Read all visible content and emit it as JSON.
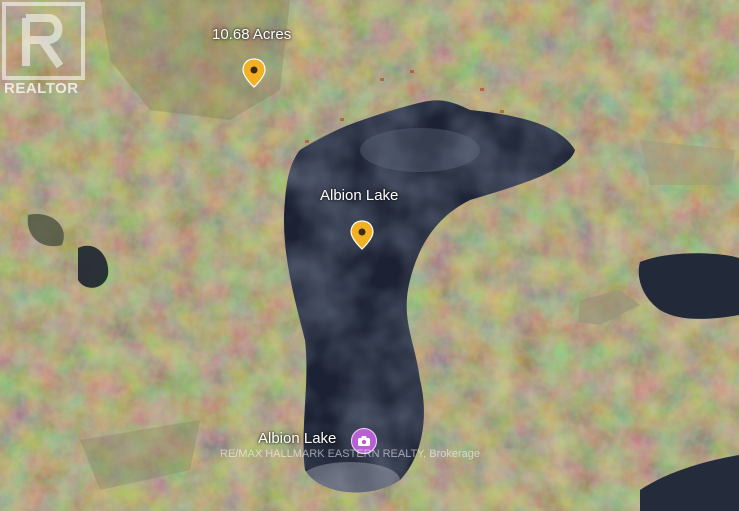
{
  "map": {
    "view": "satellite",
    "colors": {
      "lake": "#1c2233",
      "forest": "#4a4a2e",
      "marker": "#f2b022",
      "camera_badge": "#b85fd6"
    }
  },
  "markers": [
    {
      "label": "10.68 Acres",
      "icon": "map-pin-icon"
    },
    {
      "label": "Albion Lake",
      "icon": "map-pin-icon"
    }
  ],
  "place_label": {
    "text": "Albion Lake",
    "icon": "camera-icon"
  },
  "watermark": "RE/MAX HALLMARK EASTERN REALTY, Brokerage",
  "logo": {
    "text": "REALTOR",
    "mark": "R"
  }
}
